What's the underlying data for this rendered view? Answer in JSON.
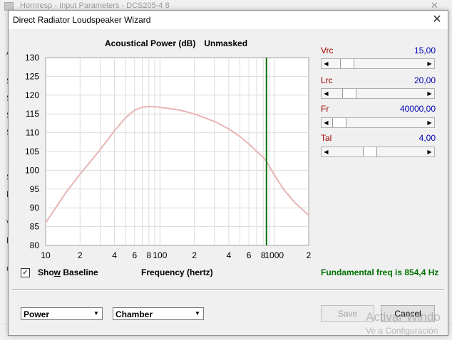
{
  "background_window": {
    "title": "Hornresp - Input Parameters - DCS205-4 8",
    "close_glyph": "✕",
    "side_letters": [
      "A",
      "S",
      "S",
      "S",
      "S",
      "S",
      "E",
      "V",
      "L",
      "C"
    ],
    "watermark": {
      "line1": "Activar Windo",
      "line2": "Ve a Configuración"
    }
  },
  "dialog": {
    "title": "Direct Radiator Loudspeaker Wizard",
    "close_glyph": "✕",
    "chart_title": "Acoustical Power (dB)",
    "chart_mode": "Unmasked",
    "controls": [
      {
        "label": "Vrc",
        "value": "15,00",
        "position": 0.12
      },
      {
        "label": "Lrc",
        "value": "20,00",
        "position": 0.14
      },
      {
        "label": "Fr",
        "value": "40000,00",
        "position": 0.02
      },
      {
        "label": "Tal",
        "value": "4,00",
        "position": 0.4
      }
    ],
    "show_baseline": {
      "label_before": "Sho",
      "label_underline": "w",
      "label_after": " Baseline",
      "checked": true,
      "check_glyph": "✓"
    },
    "freq_axis_label": "Frequency (hertz)",
    "fundamental": "Fundamental freq is 854,4 Hz",
    "combo_left": {
      "value": "Power",
      "arrow_glyph": "▼"
    },
    "combo_right": {
      "value": "Chamber",
      "arrow_glyph": "▼"
    },
    "save_label": "Save",
    "cancel_label": "Cancel",
    "arrow_left_glyph": "◀",
    "arrow_right_glyph": "▶"
  },
  "chart_data": {
    "type": "line",
    "title": "Acoustical Power (dB)   Unmasked",
    "xlabel": "Frequency (hertz)",
    "ylabel": "",
    "x_scale": "log",
    "xlim": [
      10,
      2000
    ],
    "ylim": [
      80,
      130
    ],
    "y_ticks": [
      80,
      85,
      90,
      95,
      100,
      105,
      110,
      115,
      120,
      125,
      130
    ],
    "x_ticks": [
      {
        "value": 10,
        "label": "10"
      },
      {
        "value": 20,
        "label": "2"
      },
      {
        "value": 40,
        "label": "4"
      },
      {
        "value": 60,
        "label": "6"
      },
      {
        "value": 80,
        "label": "8"
      },
      {
        "value": 100,
        "label": "100"
      },
      {
        "value": 200,
        "label": "2"
      },
      {
        "value": 400,
        "label": "4"
      },
      {
        "value": 600,
        "label": "6"
      },
      {
        "value": 800,
        "label": "8"
      },
      {
        "value": 1000,
        "label": "1000"
      },
      {
        "value": 2000,
        "label": "2"
      }
    ],
    "grid": true,
    "series": [
      {
        "color": "#e8b4b4",
        "x": [
          10,
          15,
          20,
          30,
          40,
          50,
          60,
          70,
          80,
          100,
          150,
          200,
          300,
          400,
          500,
          600,
          700,
          800,
          854.4,
          1000,
          1200,
          1500,
          2000
        ],
        "y": [
          86,
          94,
          99,
          105.5,
          110.5,
          114,
          116,
          116.8,
          117,
          116.8,
          116,
          115,
          113,
          111,
          109,
          107,
          105,
          103.5,
          102.3,
          98.8,
          95,
          91.5,
          88
        ]
      }
    ],
    "marker_line": {
      "x": 854.4,
      "color": "#007000"
    }
  }
}
